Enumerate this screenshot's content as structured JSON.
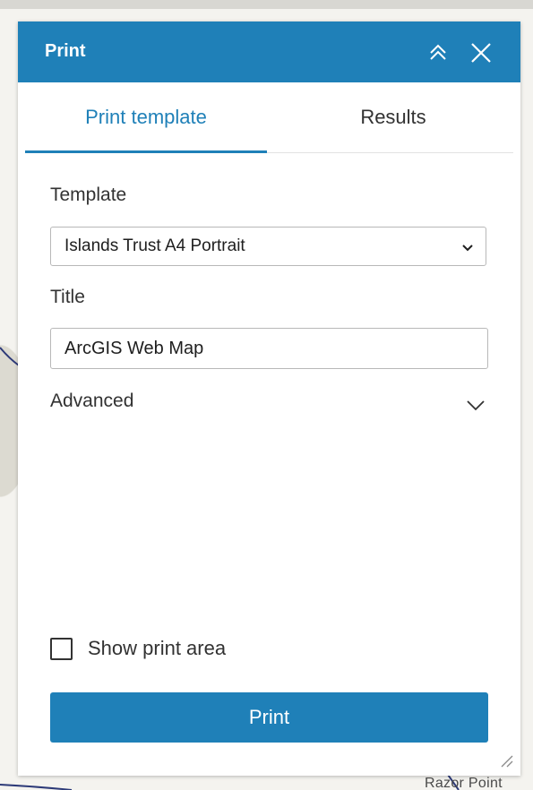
{
  "map": {
    "place_label": "Razor Point"
  },
  "panel": {
    "title": "Print",
    "icons": {
      "collapse": "double-chevron-up-icon",
      "close": "close-icon"
    }
  },
  "tabs": [
    {
      "label": "Print template",
      "active": true
    },
    {
      "label": "Results",
      "active": false
    }
  ],
  "form": {
    "template_label": "Template",
    "template_value": "Islands Trust A4 Portrait",
    "title_label": "Title",
    "title_value": "ArcGIS Web Map",
    "advanced_label": "Advanced",
    "show_print_area_label": "Show print area",
    "show_print_area_checked": false
  },
  "actions": {
    "print_label": "Print"
  },
  "colors": {
    "accent": "#1f80b8",
    "text": "#323232",
    "border": "#b8b8b8"
  }
}
